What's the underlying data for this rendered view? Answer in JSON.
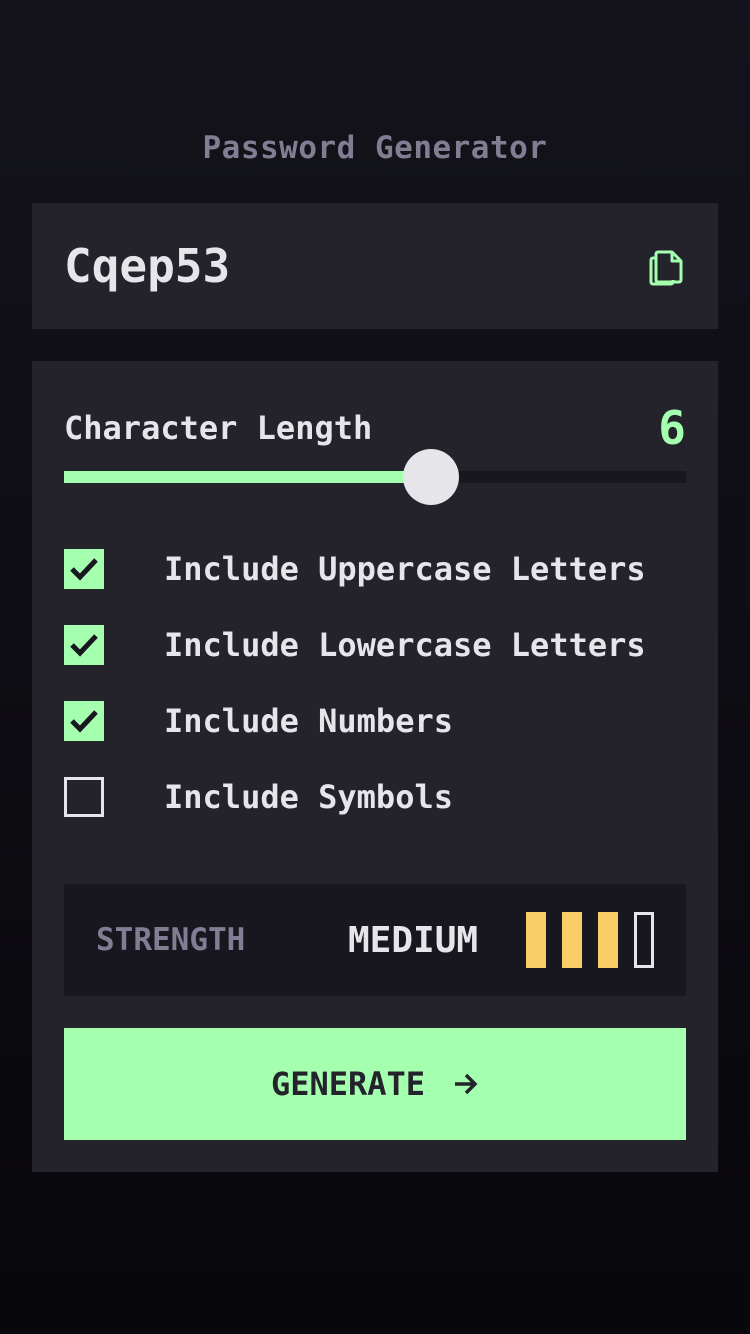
{
  "app": {
    "title": "Password Generator"
  },
  "output": {
    "password": "Cqep53",
    "copy_icon": "copy-icon"
  },
  "length": {
    "label": "Character Length",
    "value": "6",
    "slider_fraction": 0.59
  },
  "options": [
    {
      "label": "Include Uppercase Letters",
      "checked": true
    },
    {
      "label": "Include Lowercase Letters",
      "checked": true
    },
    {
      "label": "Include Numbers",
      "checked": true
    },
    {
      "label": "Include Symbols",
      "checked": false
    }
  ],
  "strength": {
    "label": "STRENGTH",
    "value": "MEDIUM",
    "level": 3,
    "max_level": 4
  },
  "generate": {
    "label": "GENERATE",
    "icon": "arrow-right-icon"
  },
  "colors": {
    "accent": "#a4ffaf",
    "strength_medium": "#f8cd65",
    "panel": "#24232c"
  }
}
